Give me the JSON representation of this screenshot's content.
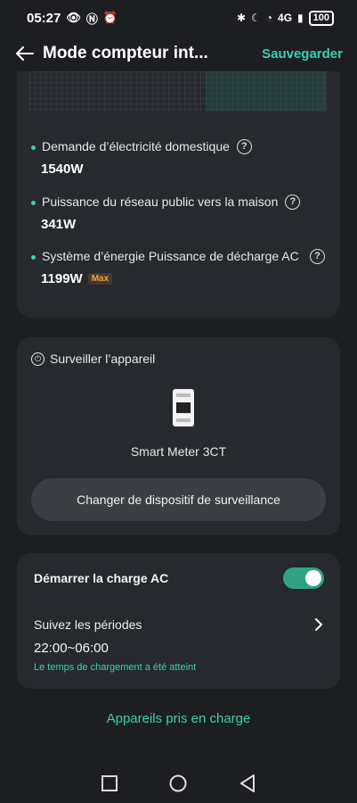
{
  "status_bar": {
    "time": "05:27",
    "right_text": "4G",
    "battery": "100"
  },
  "header": {
    "title": "Mode compteur int...",
    "save_label": "Sauvegarder"
  },
  "energy_card": {
    "metrics": [
      {
        "label": "Demande d’électricité domestique",
        "value": "1540W"
      },
      {
        "label": "Puissance du réseau public vers la maison",
        "value": "341W"
      },
      {
        "label": "Système d’énergie Puissance de décharge AC",
        "value": "1199W",
        "badge": "Max"
      }
    ]
  },
  "monitor_card": {
    "title": "Surveiller l’appareil",
    "device_name": "Smart Meter 3CT",
    "change_button": "Changer de dispositif de surveillance"
  },
  "charge_card": {
    "start_label": "Démarrer la charge AC",
    "toggle_on": true,
    "periods_label": "Suivez les périodes",
    "period_time": "22:00~06:00",
    "note": "Le temps de chargement a été atteint"
  },
  "supported_devices_link": "Appareils pris en charge",
  "colors": {
    "background": "#1c1e22",
    "card": "#26292e",
    "accent": "#3ecfb0",
    "badge": "#f1a23a"
  },
  "icons": [
    "back-arrow-icon",
    "help-icon",
    "plug-icon",
    "smart-meter-icon",
    "chevron-right-icon",
    "square-nav-icon",
    "circle-nav-icon",
    "triangle-back-nav-icon"
  ]
}
